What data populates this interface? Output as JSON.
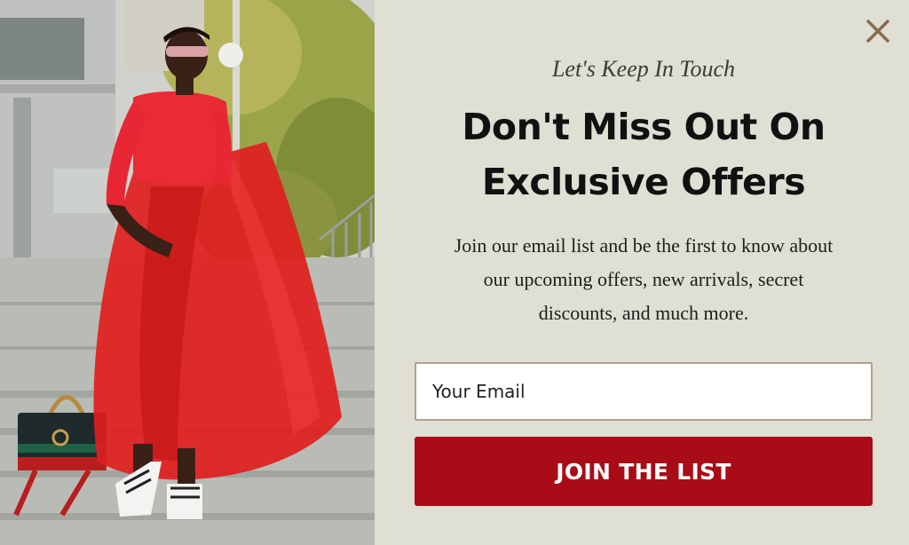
{
  "photo": {
    "alt_subject": "model-in-red-dress-on-stairs"
  },
  "popup": {
    "close_icon": "close-x-icon",
    "eyebrow": "Let's Keep In Touch",
    "headline_line1": "Don't Miss Out On",
    "headline_line2": "Exclusive Offers",
    "body_line1": "Join our email list and be the first to know about",
    "body_line2": "our upcoming offers, new arrivals, secret",
    "body_line3": "discounts, and much more.",
    "email_placeholder": "Your Email",
    "email_value": "",
    "cta_label": "JOIN THE LIST"
  },
  "colors": {
    "panel_background": "#e0dfd4",
    "cta_background": "#a80c16",
    "close_icon": "#8a6a50",
    "input_border": "#b59f8c"
  }
}
